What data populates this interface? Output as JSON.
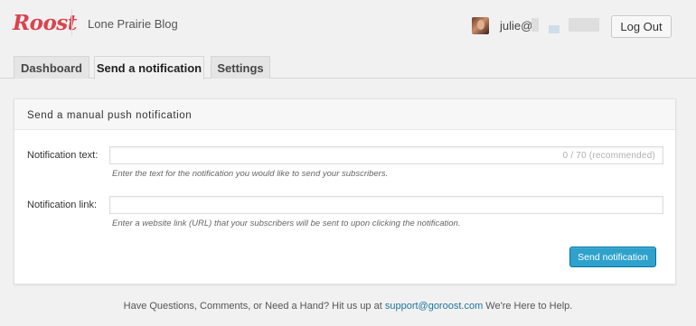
{
  "header": {
    "logo_text": "Roost",
    "site_name": "Lone Prairie Blog",
    "username": "julie@",
    "logout_label": "Log Out"
  },
  "tabs": [
    {
      "label": "Dashboard",
      "active": false
    },
    {
      "label": "Send a notification",
      "active": true
    },
    {
      "label": "Settings",
      "active": false
    }
  ],
  "panel": {
    "title": "Send a manual push notification",
    "notification_text": {
      "label": "Notification text:",
      "value": "",
      "counter": "0 / 70 (recommended)",
      "hint": "Enter the text for the notification you would like to send your subscribers."
    },
    "notification_link": {
      "label": "Notification link:",
      "value": "",
      "hint": "Enter a website link (URL) that your subscribers will be sent to upon clicking the notification."
    },
    "send_label": "Send notification"
  },
  "footer": {
    "text_before": "Have Questions, Comments, or Need a Hand? Hit us up at",
    "link_text": "support@goroost.com",
    "text_after": "We're Here to Help."
  },
  "colors": {
    "brand": "#d9444f",
    "primary_button": "#2ea2cc",
    "link": "#21759b"
  }
}
